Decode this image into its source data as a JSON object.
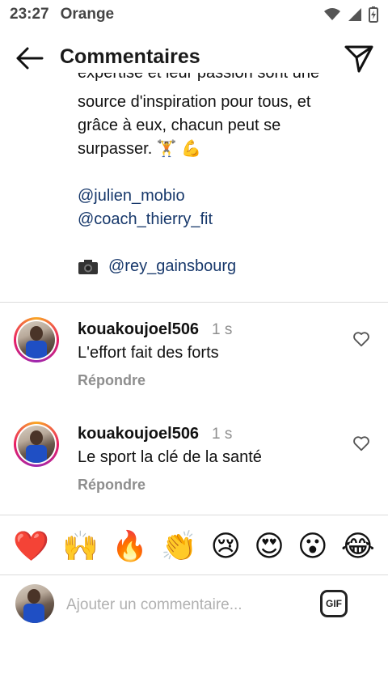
{
  "status_bar": {
    "time": "23:27",
    "carrier": "Orange"
  },
  "header": {
    "title": "Commentaires"
  },
  "caption": {
    "cut_line": "expertise et leur passion sont une",
    "lines": [
      "source d'inspiration pour tous, et",
      "grâce à eux, chacun peut se",
      "surpasser. 🏋️ 💪"
    ],
    "mentions": [
      "@julien_mobio",
      "@coach_thierry_fit"
    ],
    "photo_credit_icon": "camera-icon",
    "photo_credit": "@rey_gainsbourg"
  },
  "comments": [
    {
      "username": "kouakoujoel506",
      "time": "1 s",
      "text": "L'effort fait des forts",
      "reply_label": "Répondre"
    },
    {
      "username": "kouakoujoel506",
      "time": "1 s",
      "text": "Le sport la clé de la santé",
      "reply_label": "Répondre"
    }
  ],
  "emoji_reactions": [
    "❤️",
    "🙌",
    "🔥",
    "👏",
    "😢",
    "😍",
    "😮",
    "😂"
  ],
  "composer": {
    "placeholder": "Ajouter un commentaire...",
    "gif_label": "GIF"
  },
  "colors": {
    "mention": "#17386b",
    "muted": "#8e8e8e",
    "divider": "#dcdcdc"
  }
}
